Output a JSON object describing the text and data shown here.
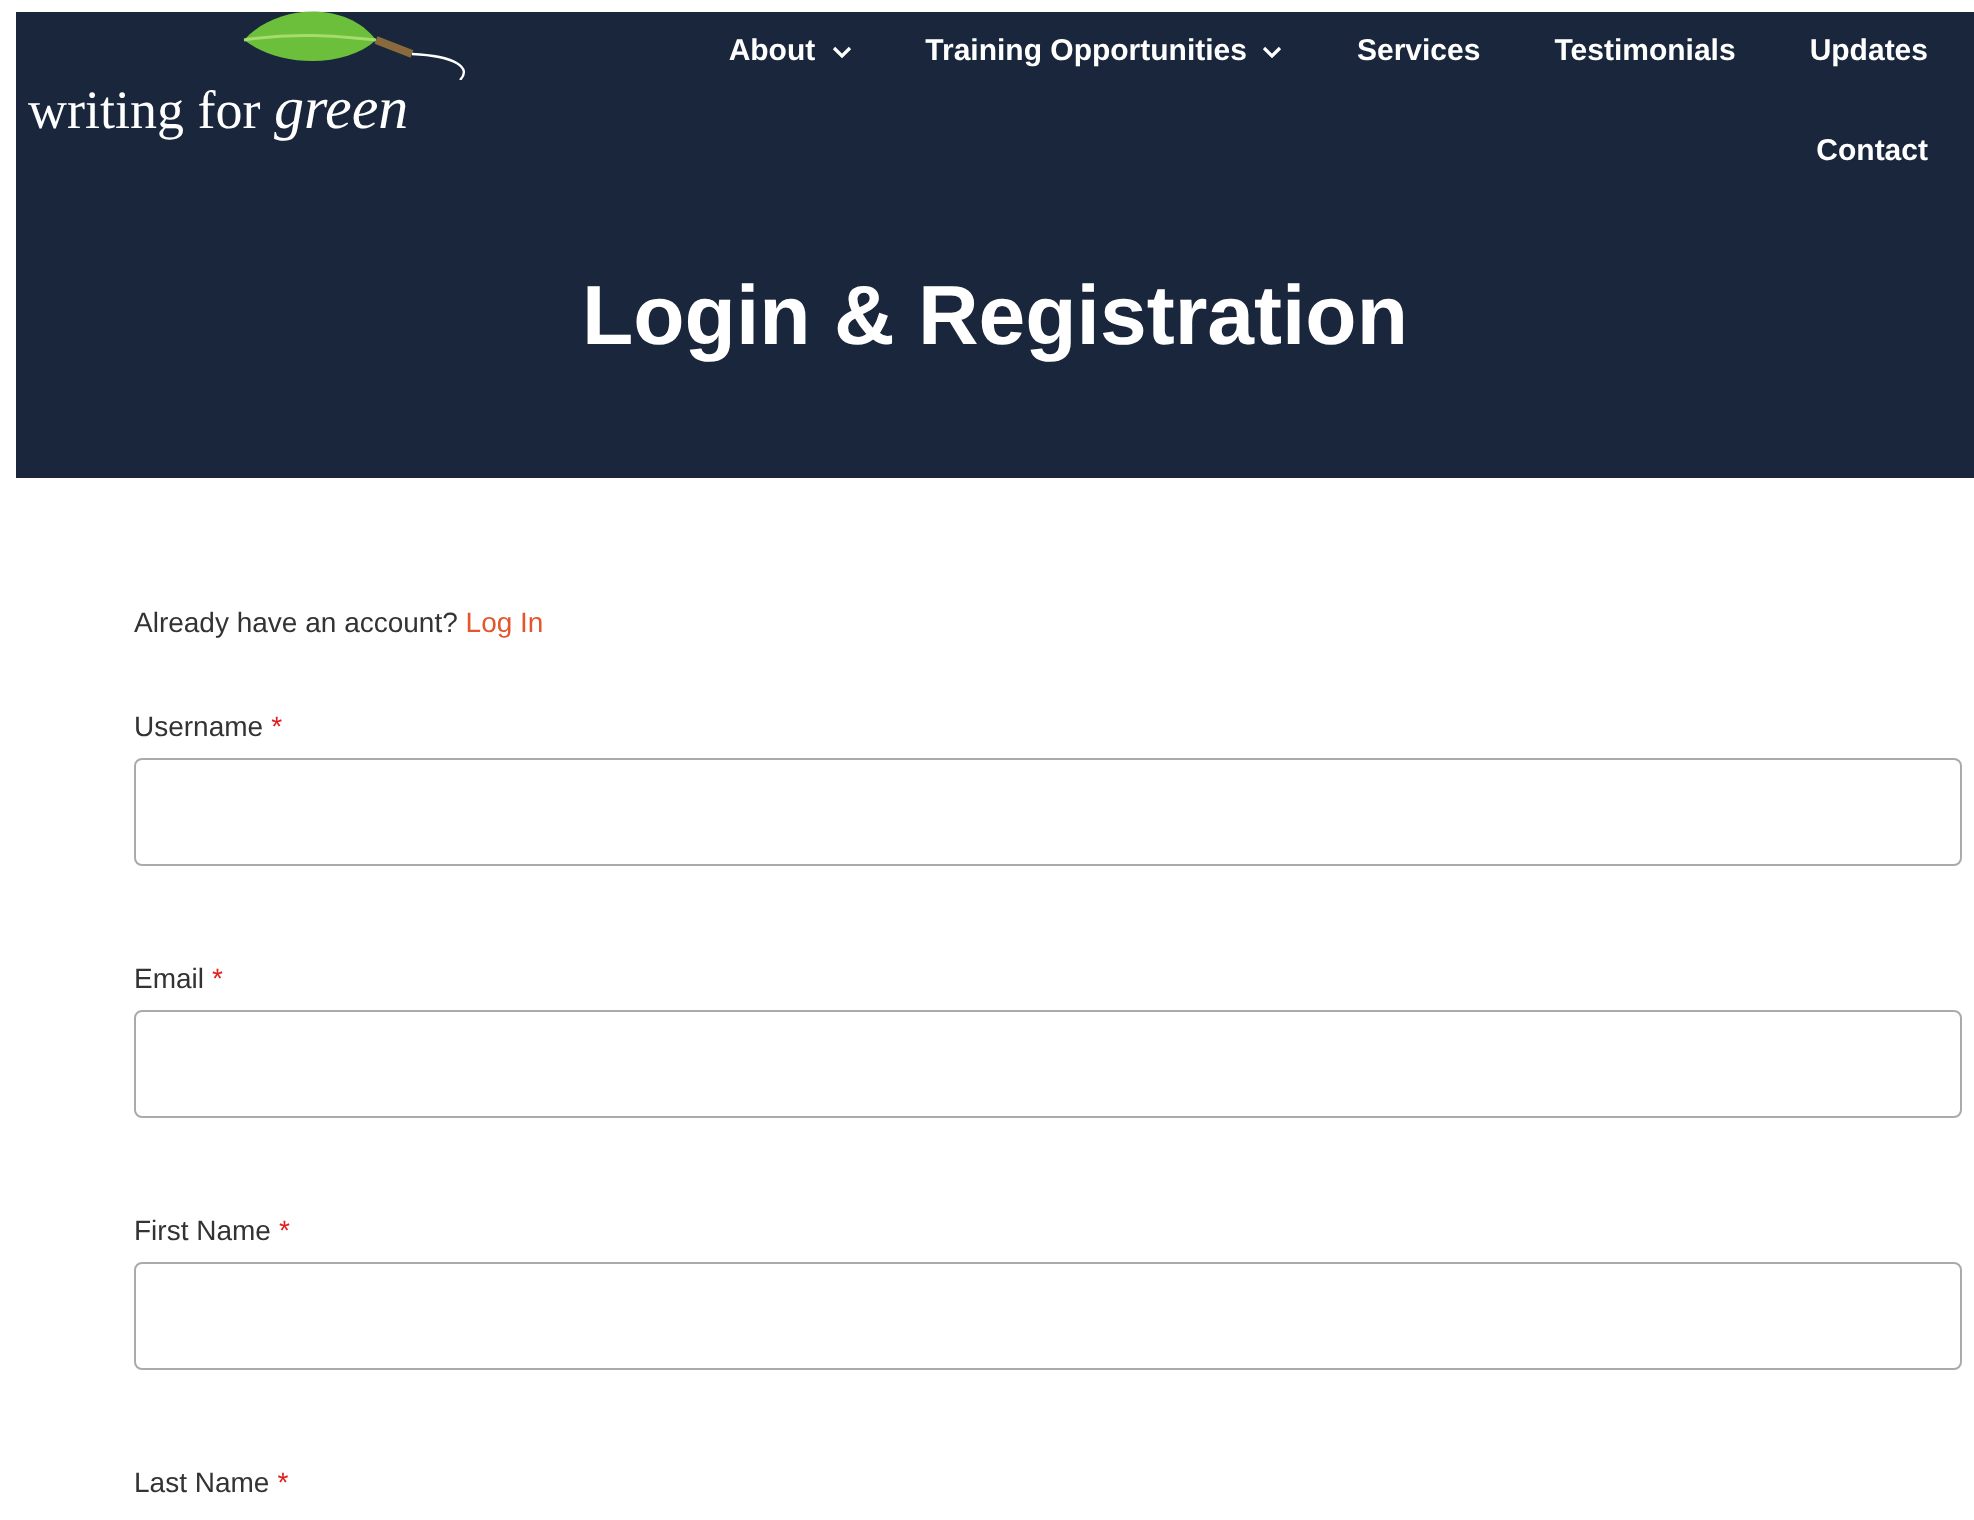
{
  "logo": {
    "text": "writing for",
    "accent": "green"
  },
  "nav": [
    {
      "label": "About",
      "dropdown": true
    },
    {
      "label": "Training Opportunities",
      "dropdown": true
    },
    {
      "label": "Services",
      "dropdown": false
    },
    {
      "label": "Testimonials",
      "dropdown": false
    },
    {
      "label": "Updates",
      "dropdown": false
    },
    {
      "label": "Contact",
      "dropdown": false
    }
  ],
  "hero": {
    "title": "Login & Registration"
  },
  "account_prompt": {
    "text": "Already have an account?",
    "link": "Log In"
  },
  "fields": [
    {
      "label": "Username",
      "required_mark": "*",
      "input_shown": true
    },
    {
      "label": "Email",
      "required_mark": "*",
      "input_shown": true
    },
    {
      "label": "First Name",
      "required_mark": "*",
      "input_shown": true
    },
    {
      "label": "Last Name",
      "required_mark": "*",
      "input_shown": false
    }
  ]
}
